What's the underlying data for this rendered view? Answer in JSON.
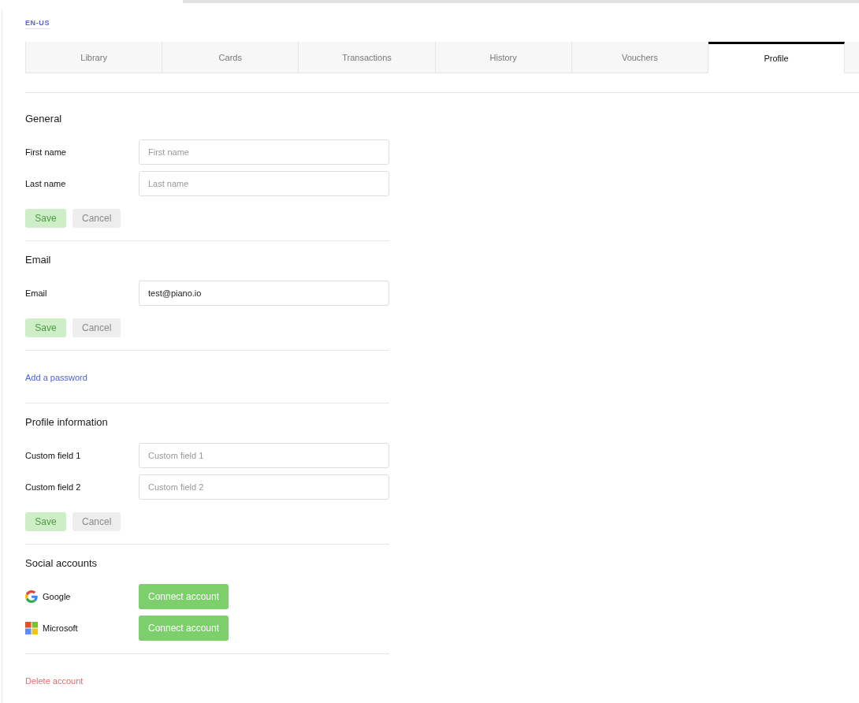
{
  "language": {
    "label": "EN-US"
  },
  "tabs": [
    {
      "label": "Library",
      "selected": false
    },
    {
      "label": "Cards",
      "selected": false
    },
    {
      "label": "Transactions",
      "selected": false
    },
    {
      "label": "History",
      "selected": false
    },
    {
      "label": "Vouchers",
      "selected": false
    },
    {
      "label": "Profile",
      "selected": true
    }
  ],
  "sections": [
    {
      "kind": "form",
      "title": "General",
      "fields": [
        {
          "label": "First name",
          "placeholder": "First name"
        },
        {
          "label": "Last name",
          "placeholder": "Last name"
        }
      ],
      "buttons": [
        {
          "kind": "save",
          "label": "Save",
          "disabled": true
        },
        {
          "kind": "cancel",
          "label": "Cancel",
          "disabled": true
        }
      ]
    },
    {
      "kind": "form",
      "title": "Email",
      "fields": [
        {
          "label": "Email",
          "value": "test@piano.io"
        }
      ],
      "buttons": [
        {
          "kind": "save",
          "label": "Save",
          "disabled": true
        },
        {
          "kind": "cancel",
          "label": "Cancel",
          "disabled": true
        }
      ]
    },
    {
      "kind": "link",
      "label": "Add a password",
      "danger": false
    },
    {
      "kind": "form",
      "title": "Profile information",
      "fields": [
        {
          "label": "Custom field 1",
          "placeholder": "Custom field 1"
        },
        {
          "label": "Custom field 2",
          "placeholder": "Custom field 2"
        }
      ],
      "buttons": [
        {
          "kind": "save",
          "label": "Save",
          "disabled": true
        },
        {
          "kind": "cancel",
          "label": "Cancel",
          "disabled": true
        }
      ]
    },
    {
      "kind": "social",
      "title": "Social accounts",
      "accounts": [
        {
          "kind": "google",
          "name": "Google",
          "button": "Connect account"
        },
        {
          "kind": "microsoft",
          "name": "Microsoft",
          "button": "Connect account"
        }
      ]
    },
    {
      "kind": "link",
      "label": "Delete account",
      "danger": true
    }
  ]
}
